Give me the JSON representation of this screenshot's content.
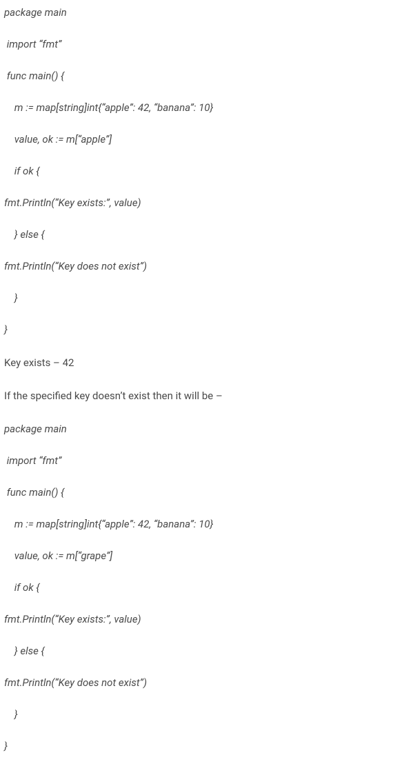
{
  "code1": {
    "lines": [
      {
        "text": "package main",
        "indent": ""
      },
      {
        "text": " import “fmt”",
        "indent": ""
      },
      {
        "text": " func main() {",
        "indent": ""
      },
      {
        "text": "    m := map[string]int{“apple”: 42, “banana”: 10}",
        "indent": ""
      },
      {
        "text": "    value, ok := m[“apple”]",
        "indent": ""
      },
      {
        "text": "    if ok {",
        "indent": ""
      },
      {
        "text": "fmt.Println(“Key exists:”, value)",
        "indent": ""
      },
      {
        "text": "    } else {",
        "indent": ""
      },
      {
        "text": "fmt.Println(“Key does not exist”)",
        "indent": ""
      },
      {
        "text": "    }",
        "indent": ""
      },
      {
        "text": "}",
        "indent": ""
      }
    ]
  },
  "output1": "Key exists – 42",
  "transition": "If the specified key doesn’t exist then it will be –",
  "code2": {
    "lines": [
      {
        "text": "package main",
        "indent": ""
      },
      {
        "text": " import “fmt”",
        "indent": ""
      },
      {
        "text": " func main() {",
        "indent": ""
      },
      {
        "text": "    m := map[string]int{“apple”: 42, “banana”: 10}",
        "indent": ""
      },
      {
        "text": "    value, ok := m[“grape”]",
        "indent": ""
      },
      {
        "text": "    if ok {",
        "indent": ""
      },
      {
        "text": "fmt.Println(“Key exists:”, value)",
        "indent": ""
      },
      {
        "text": "    } else {",
        "indent": ""
      },
      {
        "text": "fmt.Println(“Key does not exist”)",
        "indent": ""
      },
      {
        "text": "    }",
        "indent": ""
      },
      {
        "text": "}",
        "indent": ""
      }
    ]
  }
}
